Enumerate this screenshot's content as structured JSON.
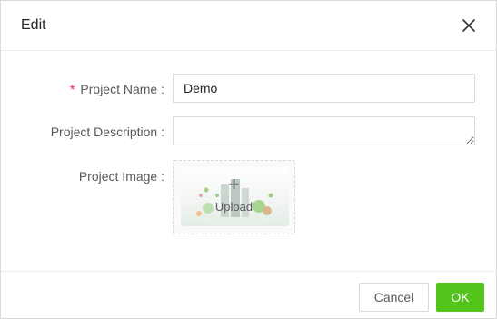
{
  "dialog": {
    "title": "Edit",
    "close_icon": "close-icon"
  },
  "form": {
    "project_name": {
      "required_mark": "*",
      "label": "Project Name :",
      "value": "Demo"
    },
    "project_description": {
      "label": "Project Description :",
      "value": ""
    },
    "project_image": {
      "label": "Project Image :",
      "upload_icon": "plus-icon",
      "upload_label": "Upload"
    }
  },
  "footer": {
    "cancel_label": "Cancel",
    "ok_label": "OK"
  },
  "colors": {
    "primary": "#52c41a",
    "required": "#f5222d"
  }
}
